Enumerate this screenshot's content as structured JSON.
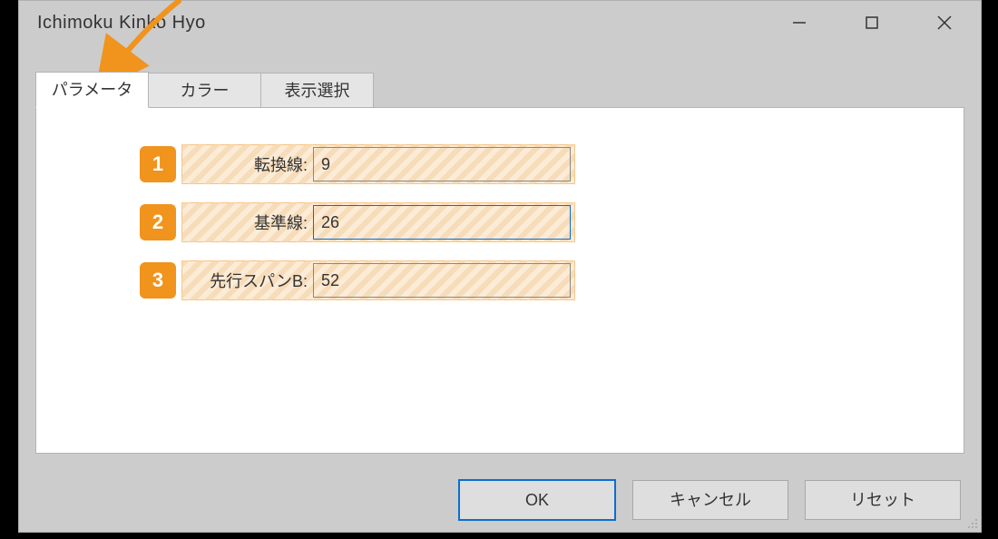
{
  "window": {
    "title": "Ichimoku Kinko Hyo"
  },
  "tabs": {
    "t0": "パラメータ",
    "t1": "カラー",
    "t2": "表示選択"
  },
  "params": {
    "row1": {
      "badge": "1",
      "label": "転換線:",
      "value": "9"
    },
    "row2": {
      "badge": "2",
      "label": "基準線:",
      "value": "26"
    },
    "row3": {
      "badge": "3",
      "label": "先行スパンB:",
      "value": "52"
    }
  },
  "buttons": {
    "ok": "OK",
    "cancel": "キャンセル",
    "reset": "リセット"
  }
}
